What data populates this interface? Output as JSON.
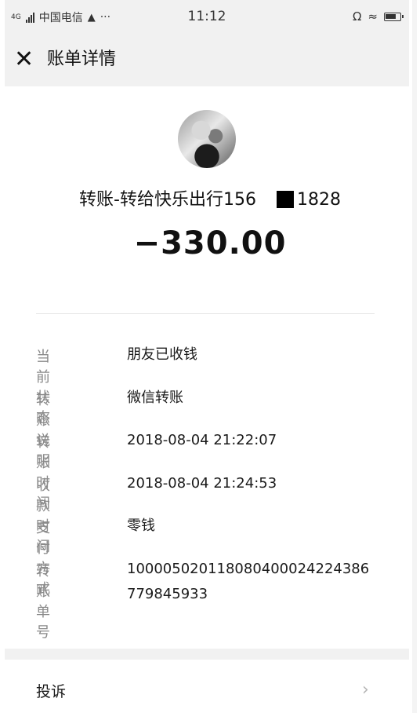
{
  "status_bar": {
    "network": "4G",
    "carrier": "中国电信",
    "more": "···",
    "time": "11:12"
  },
  "header": {
    "title": "账单详情",
    "close_icon": "close-icon"
  },
  "bill": {
    "payee_prefix": "转账-转给快乐出行156",
    "payee_suffix": "1828",
    "amount": "−330.00"
  },
  "details": [
    {
      "label": "当前状态",
      "value": "朋友已收钱"
    },
    {
      "label": "转账说明",
      "value": "微信转账"
    },
    {
      "label": "转账时间",
      "value": "2018-08-04 21:22:07"
    },
    {
      "label": "收款时间",
      "value": "2018-08-04 21:24:53"
    },
    {
      "label": "支付方式",
      "value": "零钱"
    },
    {
      "label": "转账单号",
      "value": "100005020118080400024224386779845933"
    }
  ],
  "complaint": {
    "label": "投诉"
  }
}
